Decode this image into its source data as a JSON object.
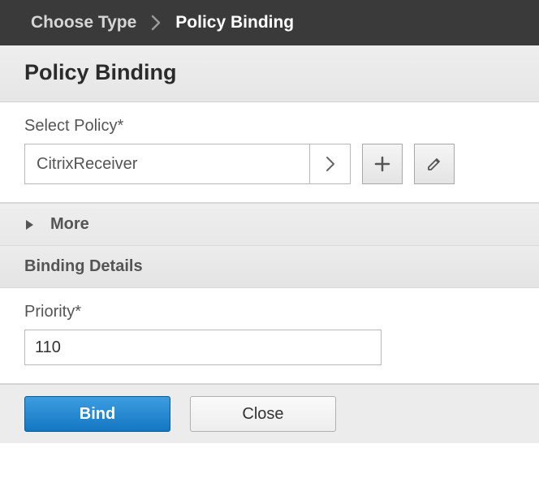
{
  "breadcrumb": {
    "prev": "Choose Type",
    "current": "Policy Binding"
  },
  "page_title": "Policy Binding",
  "select_policy": {
    "label": "Select Policy*",
    "value": "CitrixReceiver"
  },
  "more": {
    "label": "More"
  },
  "binding_details": {
    "header": "Binding Details",
    "priority_label": "Priority*",
    "priority_value": "110"
  },
  "actions": {
    "bind": "Bind",
    "close": "Close"
  }
}
